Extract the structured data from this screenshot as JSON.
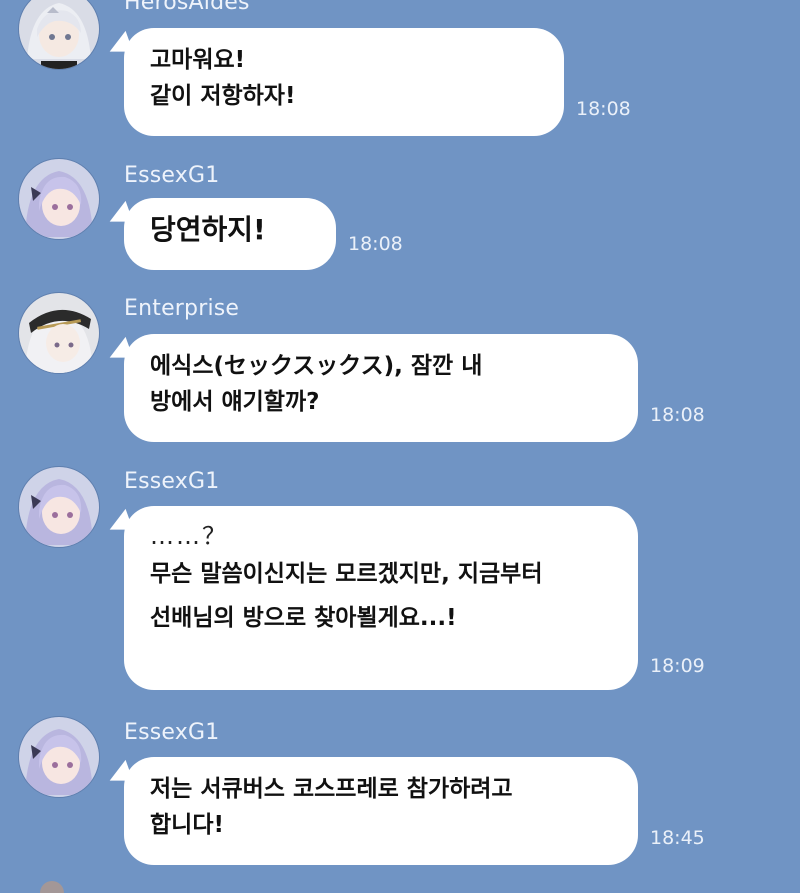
{
  "messages": [
    {
      "sender": "HerosAides",
      "lines": [
        "고마워요!",
        "같이 저항하자!"
      ],
      "time": "18:08",
      "avatar_icon": "silver-hair-avatar-icon"
    },
    {
      "sender": "EssexG1",
      "lines": [
        "당연하지!"
      ],
      "time": "18:08",
      "avatar_icon": "lavender-hair-avatar-icon"
    },
    {
      "sender": "Enterprise",
      "lines": [
        "에식스(セックスックス), 잠깐 내",
        "방에서 얘기할까?"
      ],
      "time": "18:08",
      "avatar_icon": "white-hair-cap-avatar-icon"
    },
    {
      "sender": "EssexG1",
      "lines": [
        "……？",
        "무슨 말씀이신지는 모르겠지만, 지금부터",
        "선배님의 방으로 찾아뵐게요...!"
      ],
      "time": "18:09",
      "avatar_icon": "lavender-hair-avatar-icon"
    },
    {
      "sender": "EssexG1",
      "lines": [
        "저는 서큐버스 코스프레로 참가하려고",
        "합니다!"
      ],
      "time": "18:45",
      "avatar_icon": "lavender-hair-avatar-icon"
    }
  ],
  "colors": {
    "background": "#7094c4",
    "bubble": "#ffffff",
    "meta_text": "#eef3fb"
  }
}
